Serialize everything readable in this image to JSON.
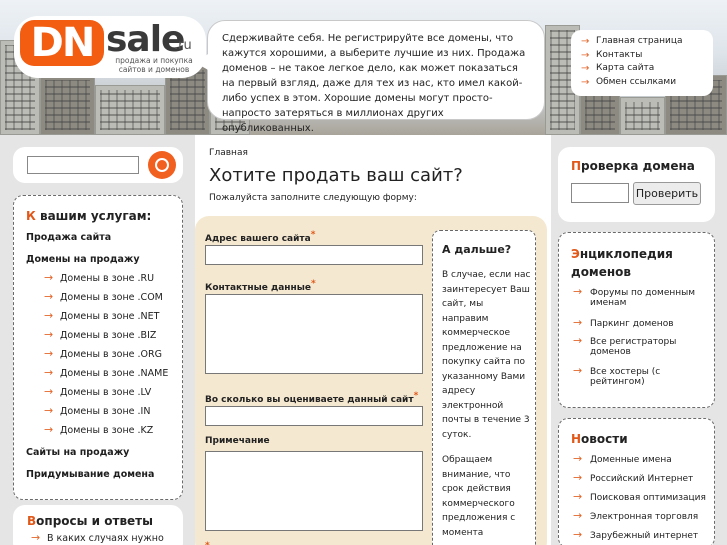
{
  "header": {
    "logo": {
      "dn": "DN",
      "sale": "sale",
      "tld": ".ru",
      "tagline": "продажа и покупка сайтов и доменов"
    },
    "bubble_text": "Сдерживайте себя. Не регистрируйте все домены, что кажутся хорошими, а выберите лучшие из них. Продажа доменов – не такое легкое дело, как может показаться на первый взгляд, даже для тех из нас, кто имел какой-либо успех в этом. Хорошие домены могут просто-напросто затеряться в миллионах других опубликованных.",
    "nav": [
      "Главная страница",
      "Контакты",
      "Карта сайта",
      "Обмен ссылками"
    ]
  },
  "left": {
    "search_value": "",
    "services": {
      "title_first": "К",
      "title_rest": " вашим услугам:",
      "items": [
        {
          "label": "Продажа сайта",
          "sub": []
        },
        {
          "label": "Домены на продажу",
          "sub": [
            "Домены в зоне .RU",
            "Домены в зоне .COM",
            "Домены в зоне .NET",
            "Домены в зоне .BIZ",
            "Домены в зоне .ORG",
            "Домены в зоне .NAME",
            "Домены в зоне .LV",
            "Домены в зоне .IN",
            "Домены в зоне .KZ"
          ]
        },
        {
          "label": "Сайты на продажу",
          "sub": []
        },
        {
          "label": "Придумывание домена",
          "sub": []
        }
      ]
    },
    "qa": {
      "title_first": "В",
      "title_rest": "опросы и ответы",
      "item": "В каких случаях нужно"
    }
  },
  "main": {
    "breadcrumb": "Главная",
    "title": "Хотите продать ваш сайт?",
    "hint": "Пожалуйста заполните следующую форму:",
    "form": {
      "address_label": "Адрес вашего сайта",
      "contacts_label": "Контактные данные",
      "price_label": "Во сколько вы оцениваете данный сайт",
      "note_label": "Примечание",
      "required": "*"
    },
    "side": {
      "title": "А дальше?",
      "p1": "В случае, если нас заинтересует Ваш сайт, мы направим коммерческое предложение на покупку сайта по указанному Вами адресу электронной почты в течение 3 суток.",
      "p2": "Обращаем внимание, что срок действия коммерческого предложения с момента"
    }
  },
  "right": {
    "check": {
      "title_first": "П",
      "title_rest": "роверка домена",
      "button": "Проверить",
      "value": ""
    },
    "encyclopedia": {
      "title_first": "Э",
      "title_rest": "нциклопедия доменов",
      "items": [
        "Форумы по доменным именам",
        "Паркинг доменов",
        "Все регистраторы доменов",
        "Все хостеры (с рейтингом)"
      ]
    },
    "news": {
      "title_first": "Н",
      "title_rest": "овости",
      "items": [
        "Доменные имена",
        "Российский Интернет",
        "Поисковая оптимизация",
        "Электронная торговля",
        "Зарубежный интернет"
      ]
    }
  },
  "colors": {
    "accent": "#f25d11",
    "form_bg": "#f5e8d0",
    "page_bg": "#e5e5e5"
  },
  "icons": {
    "search": "search-icon",
    "arrow": "arrow-right-icon"
  }
}
